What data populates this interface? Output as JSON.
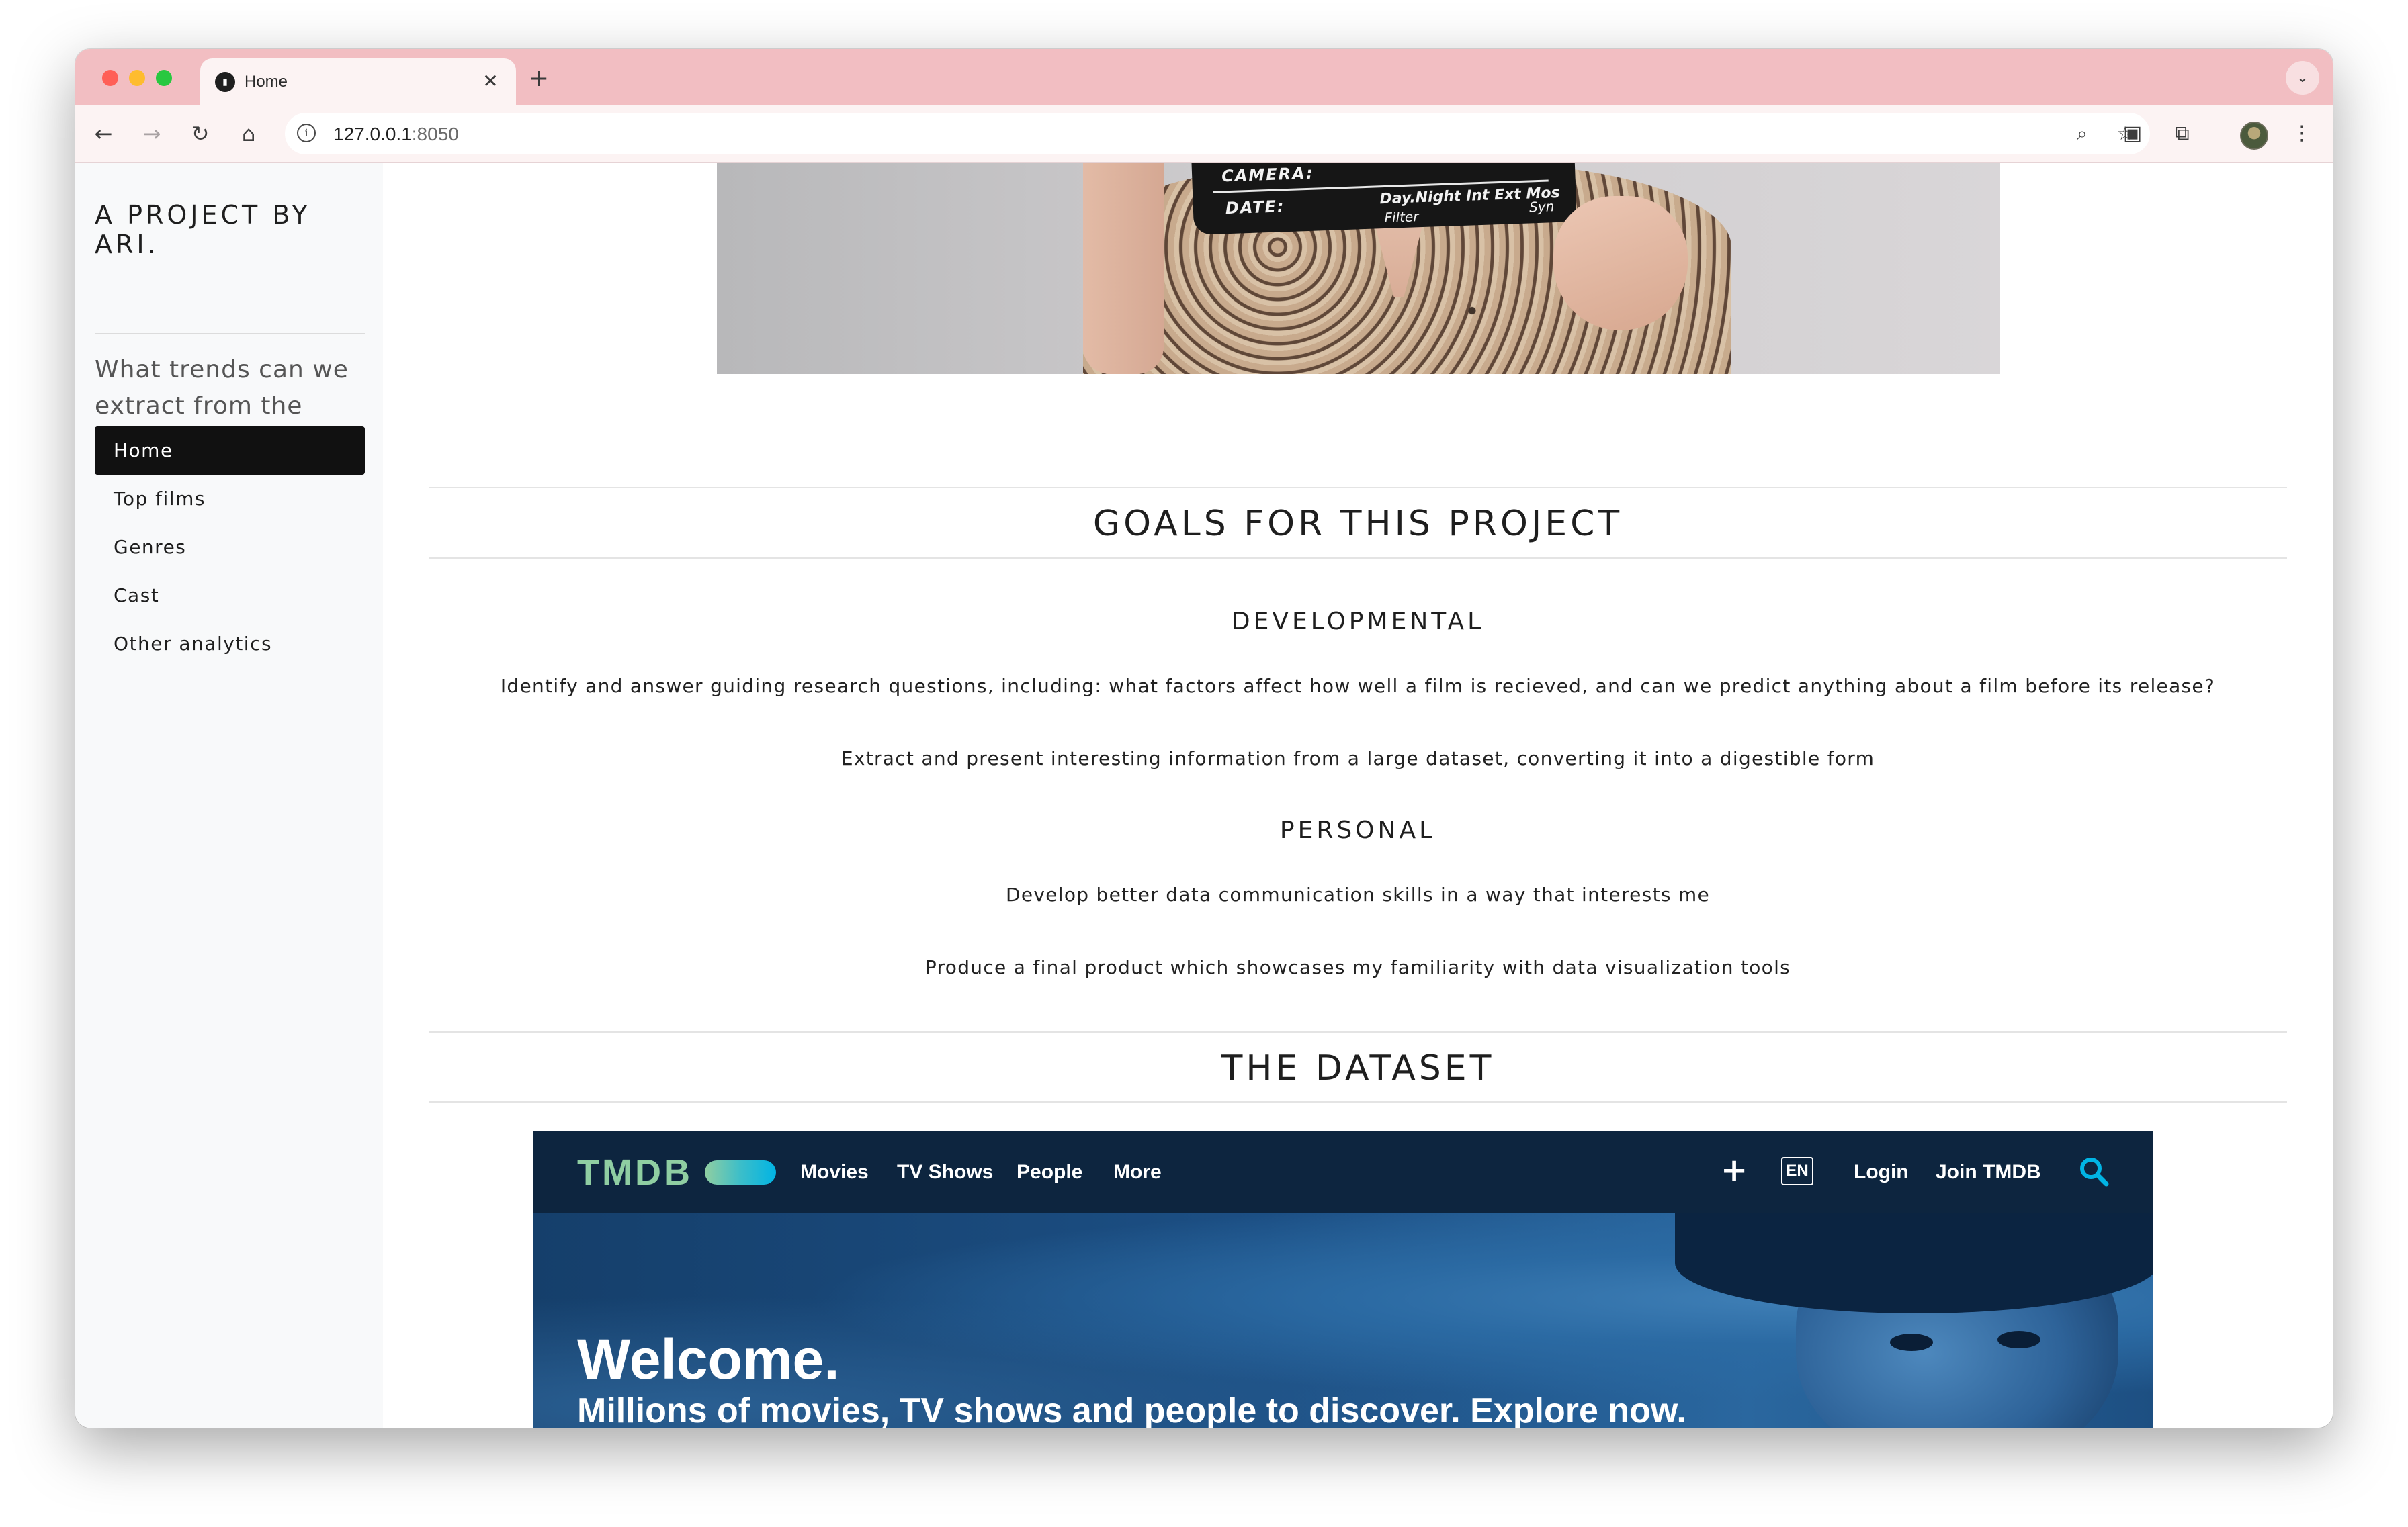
{
  "browser": {
    "tab_title": "Home",
    "tab_close": "✕",
    "new_tab": "+",
    "tab_menu": "⌄",
    "url_host": "127.0.0.1",
    "url_port": ":8050",
    "icons": [
      "back-icon",
      "forward-icon",
      "reload-icon",
      "home-icon",
      "site-info-icon",
      "zoom-icon",
      "bookmark-star-icon",
      "picture-in-picture-icon",
      "extensions-icon",
      "profile-avatar",
      "menu-kebab-icon"
    ]
  },
  "sidebar": {
    "brand": "A PROJECT BY ARI.",
    "lead": "What trends can we extract from the database?",
    "items": [
      {
        "label": "Home",
        "active": true
      },
      {
        "label": "Top films",
        "active": false
      },
      {
        "label": "Genres",
        "active": false
      },
      {
        "label": "Cast",
        "active": false
      },
      {
        "label": "Other analytics",
        "active": false
      }
    ]
  },
  "hero_photo": {
    "clapper_camera": "CAMERA:",
    "clapper_date": "DATE:",
    "clapper_daynight": "Day.Night  Int  Ext  Mos",
    "clapper_filter": "Filter",
    "clapper_sync": "Syn"
  },
  "goals": {
    "title": "GOALS FOR THIS PROJECT",
    "developmental": {
      "heading": "DEVELOPMENTAL",
      "items": [
        "Identify and answer guiding research questions, including: what factors affect how well a film is recieved, and can we predict anything about a film before its release?",
        "Extract and present interesting information from a large dataset, converting it into a digestible form"
      ]
    },
    "personal": {
      "heading": "PERSONAL",
      "items": [
        "Develop better data communication skills in a way that interests me",
        "Produce a final product which showcases my familiarity with data visualization tools"
      ]
    }
  },
  "dataset": {
    "title": "THE DATASET",
    "tmdb": {
      "logo": "TMDB",
      "nav": [
        "Movies",
        "TV Shows",
        "People",
        "More"
      ],
      "plus": "+",
      "lang": "EN",
      "login": "Login",
      "join": "Join TMDB",
      "welcome": "Welcome.",
      "tagline": "Millions of movies, TV shows and people to discover. Explore now."
    }
  },
  "colors": {
    "tab_strip": "#f2bec2",
    "toolbar": "#fcf3f3",
    "sidebar_bg": "#f8f9fa",
    "nav_active": "#111111",
    "tmdb_navy": "#0d253f",
    "tmdb_green": "#90cea1",
    "tmdb_blue": "#01b4e4"
  }
}
